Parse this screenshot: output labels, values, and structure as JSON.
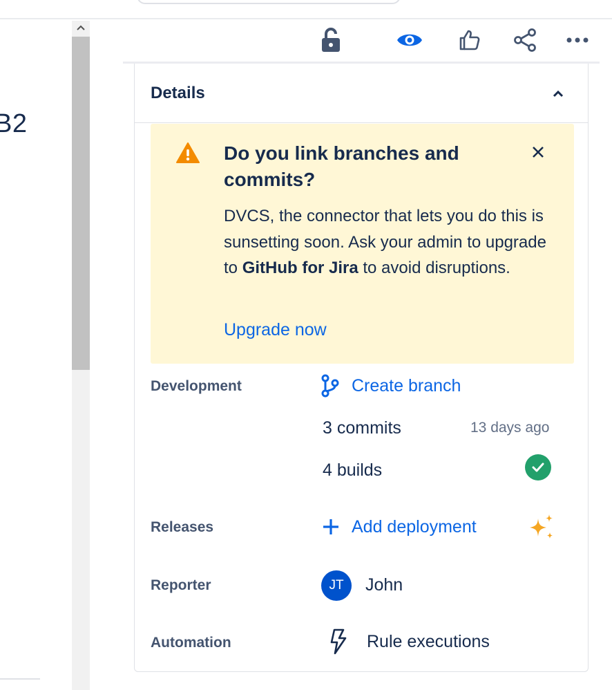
{
  "left": {
    "title_fragment": "B2"
  },
  "details": {
    "title": "Details"
  },
  "banner": {
    "title": "Do you link branches and commits?",
    "body_part1": "DVCS, the connector that lets you do this is sunsetting soon. Ask your admin to upgrade to ",
    "body_bold": "GitHub for Jira",
    "body_part2": " to avoid disruptions.",
    "link": "Upgrade now"
  },
  "development": {
    "label": "Development",
    "create_branch": "Create branch",
    "commits": "3 commits",
    "commits_time": "13 days ago",
    "builds": "4 builds"
  },
  "releases": {
    "label": "Releases",
    "add_deployment": "Add deployment"
  },
  "reporter": {
    "label": "Reporter",
    "initials": "JT",
    "name": "John"
  },
  "automation": {
    "label": "Automation",
    "value": "Rule executions"
  },
  "colors": {
    "link": "#0c66e4",
    "banner_bg": "#fff7d6",
    "warning": "#f38b00",
    "success": "#22a06b",
    "avatar": "#0052cc",
    "sparkle": "#f5a623"
  },
  "icons": [
    "lock-open-icon",
    "eye-icon",
    "thumbs-up-icon",
    "share-icon",
    "more-icon",
    "chevron-up-icon",
    "warning-icon",
    "close-icon",
    "branch-icon",
    "check-circle-icon",
    "plus-icon",
    "sparkle-icon",
    "lightning-icon"
  ]
}
